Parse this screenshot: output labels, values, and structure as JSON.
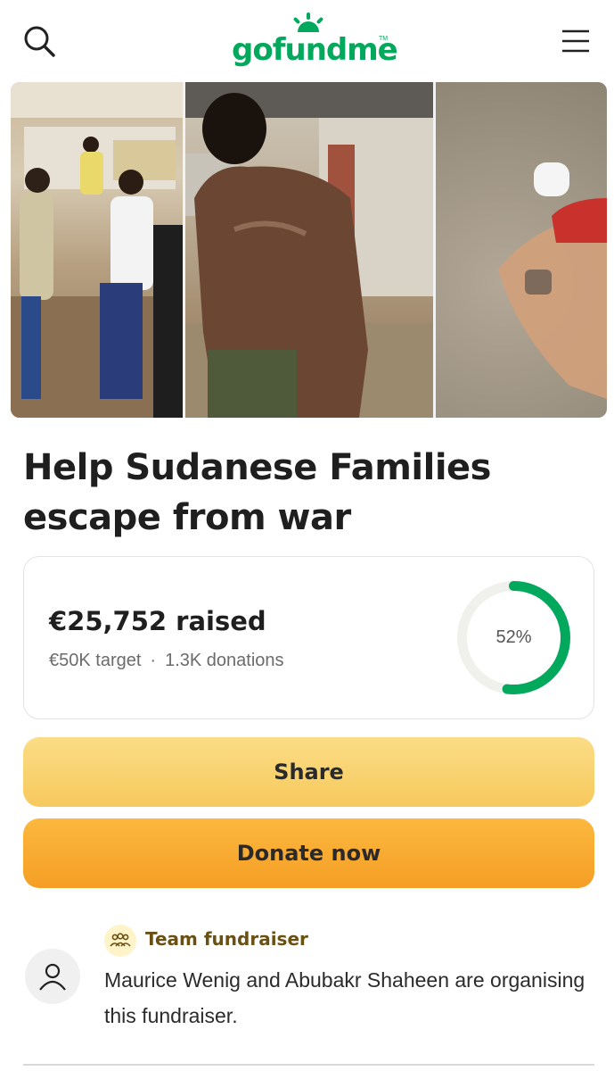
{
  "header": {
    "logo_text": "gofundme",
    "logo_tm": "TM",
    "icons": {
      "search": "search-icon",
      "menu": "hamburger-menu-icon"
    },
    "brand_color": "#02a95c"
  },
  "campaign": {
    "title": "Help Sudanese Families escape from war",
    "photos": [
      {
        "icon": "photo-people-gathered"
      },
      {
        "icon": "photo-injured-back"
      },
      {
        "icon": "photo-person-on-ground"
      }
    ]
  },
  "progress": {
    "raised": "€25,752 raised",
    "target": "€50K target",
    "separator": "·",
    "donations": "1.3K donations",
    "percent_label": "52%",
    "percent_value": 0.52,
    "ring_color": "#02a95c",
    "track_color": "#f0f0ec"
  },
  "actions": {
    "share_label": "Share",
    "donate_label": "Donate now",
    "share_color": "#f8cf66",
    "donate_color": "#f7a72c"
  },
  "organiser": {
    "team_label": "Team fundraiser",
    "team_icon": "team-people-icon",
    "avatar_icon": "user-avatar-icon",
    "text": "Maurice Wenig and Abubakr Shaheen are organising this fundraiser."
  }
}
